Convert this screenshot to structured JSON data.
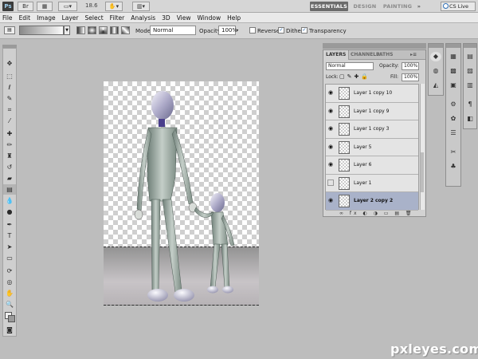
{
  "appbar": {
    "logo": "Ps",
    "zoom": "18.6",
    "workspaces": [
      "ESSENTIALS",
      "DESIGN",
      "PAINTING"
    ],
    "more": "»",
    "cs_live": "CS Live"
  },
  "menu": [
    "File",
    "Edit",
    "Image",
    "Layer",
    "Select",
    "Filter",
    "Analysis",
    "3D",
    "View",
    "Window",
    "Help"
  ],
  "options": {
    "mode_label": "Mode:",
    "mode_value": "Normal",
    "opacity_label": "Opacity:",
    "opacity_value": "100%",
    "reverse_label": "Reverse",
    "dither_label": "Dither",
    "transparency_label": "Transparency",
    "reverse_checked": false,
    "dither_checked": true,
    "transparency_checked": true
  },
  "layers_panel": {
    "tabs": [
      "LAYERS",
      "CHANNELS",
      "PATHS"
    ],
    "blend_mode": "Normal",
    "opacity_label": "Opacity:",
    "opacity_value": "100%",
    "lock_label": "Lock:",
    "fill_label": "Fill:",
    "fill_value": "100%",
    "layers": [
      {
        "name": "Layer 1 copy 10",
        "visible": true,
        "selected": false
      },
      {
        "name": "Layer 1 copy 9",
        "visible": true,
        "selected": false
      },
      {
        "name": "Layer 1 copy 3",
        "visible": true,
        "selected": false
      },
      {
        "name": "Layer 5",
        "visible": true,
        "selected": false
      },
      {
        "name": "Layer 6",
        "visible": true,
        "selected": false
      },
      {
        "name": "Layer 1",
        "visible": false,
        "selected": false
      },
      {
        "name": "Layer 2 copy 2",
        "visible": true,
        "selected": true
      }
    ]
  },
  "icons": {
    "eye": "eye-icon",
    "lock": "lock-icon",
    "link": "link-icon"
  },
  "watermark": "pxleyes.com"
}
